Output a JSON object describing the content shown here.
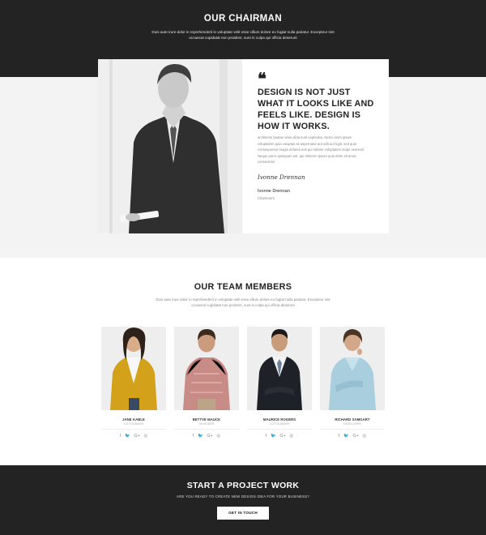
{
  "chairman_section": {
    "title": "OUR CHAIRMAN",
    "intro": "Duis aute irure dolor in reprehenderit in voluptate velit esse cillum dolore eu fugiat nulla pariatur. Excepteur sint occaecat cupidatat non proident, sunt in culpa qui officia deserunt"
  },
  "chairman_quote": {
    "quote_symbol": "❝",
    "headline": "DESIGN IS NOT JUST WHAT IT LOOKS LIKE AND FEELS LIKE. DESIGN IS HOW IT WORKS.",
    "body": "architecto beatae vitae dicta sunt explicabo. Nemo enim ipsam voluptatem quia voluptas sit aspernatur aut odit aut fugit, sed quia consequuntur magni dolores eos qui ratione voluptatem sequi nesciunt Neque porro quisquam est, qui dolorem ipsum quia dolor sit amet, consectetur",
    "signature": "Ivonne Drennan",
    "name": "Ivonne Drennan",
    "role": "Chairman's"
  },
  "team_section": {
    "title": "OUR TEAM MEMBERS",
    "intro": "Duis aute irure dolor in reprehenderit in voluptate velit esse cillum dolore eu fugiat nulla pariatur. Excepteur sint occaecat cupidatat non proident, sunt in culpa qui officia deserunt"
  },
  "team_members": [
    {
      "name": "JANE KABLE",
      "role": "CO FOUNDER"
    },
    {
      "name": "BETTVE MAUCK",
      "role": "DESIGNER"
    },
    {
      "name": "MAURICE ROGERS",
      "role": "CO FOUNDER"
    },
    {
      "name": "RICHARD SAMGART",
      "role": "DEVELOPER"
    }
  ],
  "social_icons": [
    "facebook-icon",
    "twitter-icon",
    "google-plus-icon",
    "instagram-icon"
  ],
  "social_glyphs": [
    "f",
    "🐦",
    "G+",
    "◎"
  ],
  "cta": {
    "title": "START A PROJECT WORK",
    "subtitle": "ARE YOU READY TO CREATE NEW DESIGN IDEA FOR YOUR BUSINESS?",
    "button": "GET IN TOUCH"
  },
  "colors": {
    "dark": "#232323",
    "light_gray": "#f3f3f3",
    "white": "#ffffff"
  }
}
